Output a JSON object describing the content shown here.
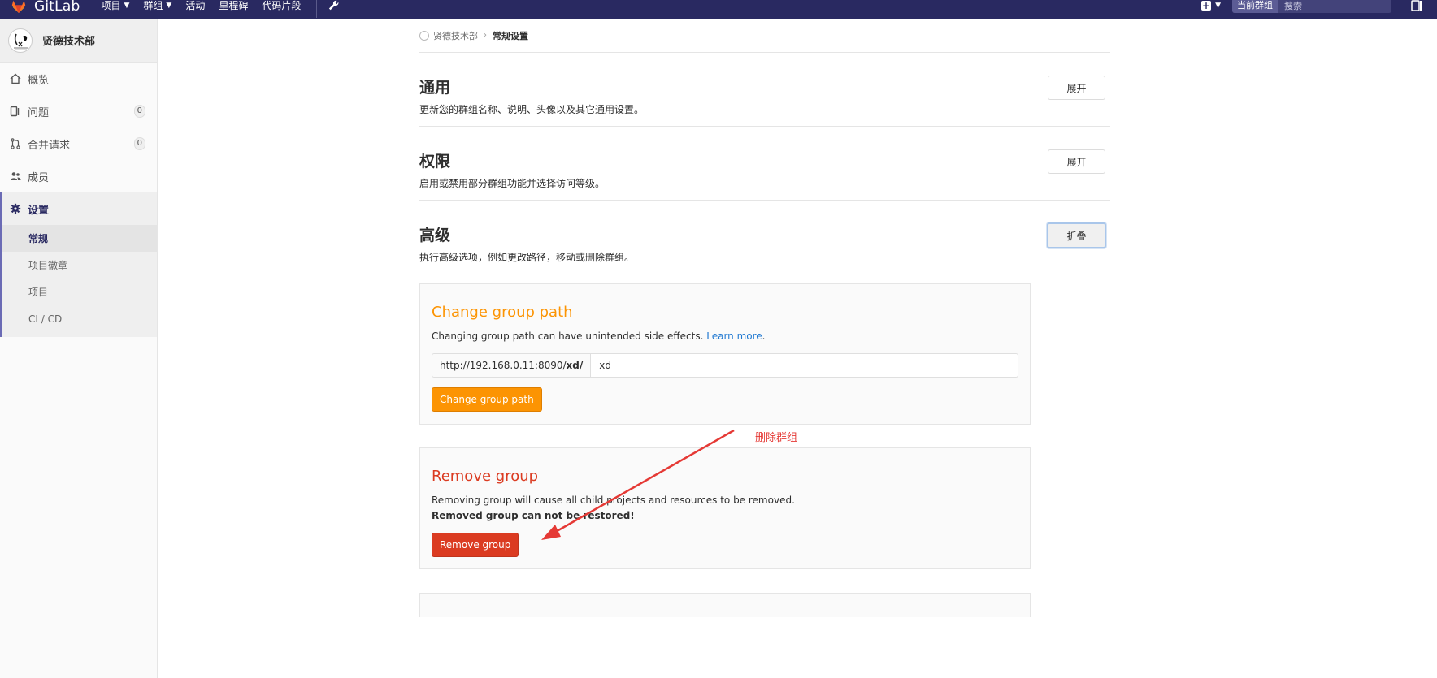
{
  "navbar": {
    "brand": "GitLab",
    "items": [
      {
        "label": "项目",
        "has_caret": true
      },
      {
        "label": "群组",
        "has_caret": true
      },
      {
        "label": "活动",
        "has_caret": false
      },
      {
        "label": "里程碑",
        "has_caret": false
      },
      {
        "label": "代码片段",
        "has_caret": false
      }
    ],
    "search_scope": "当前群组",
    "search_placeholder": "搜索",
    "icons": [
      "gitlab-logo",
      "wrench-icon",
      "plus-icon",
      "search-icon",
      "todo-icon"
    ]
  },
  "sidebar": {
    "group_name": "贤德技术部",
    "items": [
      {
        "label": "概览",
        "icon": "home-icon"
      },
      {
        "label": "问题",
        "icon": "issues-icon",
        "badge": "0"
      },
      {
        "label": "合并请求",
        "icon": "merge-request-icon",
        "badge": "0"
      },
      {
        "label": "成员",
        "icon": "users-icon"
      },
      {
        "label": "设置",
        "icon": "gear-icon",
        "active": true
      }
    ],
    "sub_items": [
      {
        "label": "常规",
        "active": true
      },
      {
        "label": "项目徽章"
      },
      {
        "label": "项目"
      },
      {
        "label": "CI / CD"
      }
    ]
  },
  "breadcrumb": {
    "parent": "贤德技术部",
    "current": "常规设置"
  },
  "sections": [
    {
      "title": "通用",
      "description": "更新您的群组名称、说明、头像以及其它通用设置。",
      "button": "展开"
    },
    {
      "title": "权限",
      "description": "启用或禁用部分群组功能并选择访问等级。",
      "button": "展开"
    },
    {
      "title": "高级",
      "description": "执行高级选项，例如更改路径，移动或删除群组。",
      "button": "折叠"
    }
  ],
  "change_path": {
    "title": "Change group path",
    "description": "Changing group path can have unintended side effects.",
    "learn_more": "Learn more",
    "period": ".",
    "prefix_text": "http://192.168.0.11:8090/",
    "prefix_bold": "xd/",
    "input_value": "xd",
    "button": "Change group path"
  },
  "remove_group": {
    "title": "Remove group",
    "description": "Removing group will cause all child projects and resources to be removed.",
    "warning": "Removed group can not be restored!",
    "button": "Remove group"
  },
  "annotation": {
    "label": "删除群组"
  },
  "colors": {
    "navbar": "#292961",
    "warning": "#fc9403",
    "danger": "#db3b21",
    "link": "#1f78d1",
    "annotation": "#e53935"
  }
}
